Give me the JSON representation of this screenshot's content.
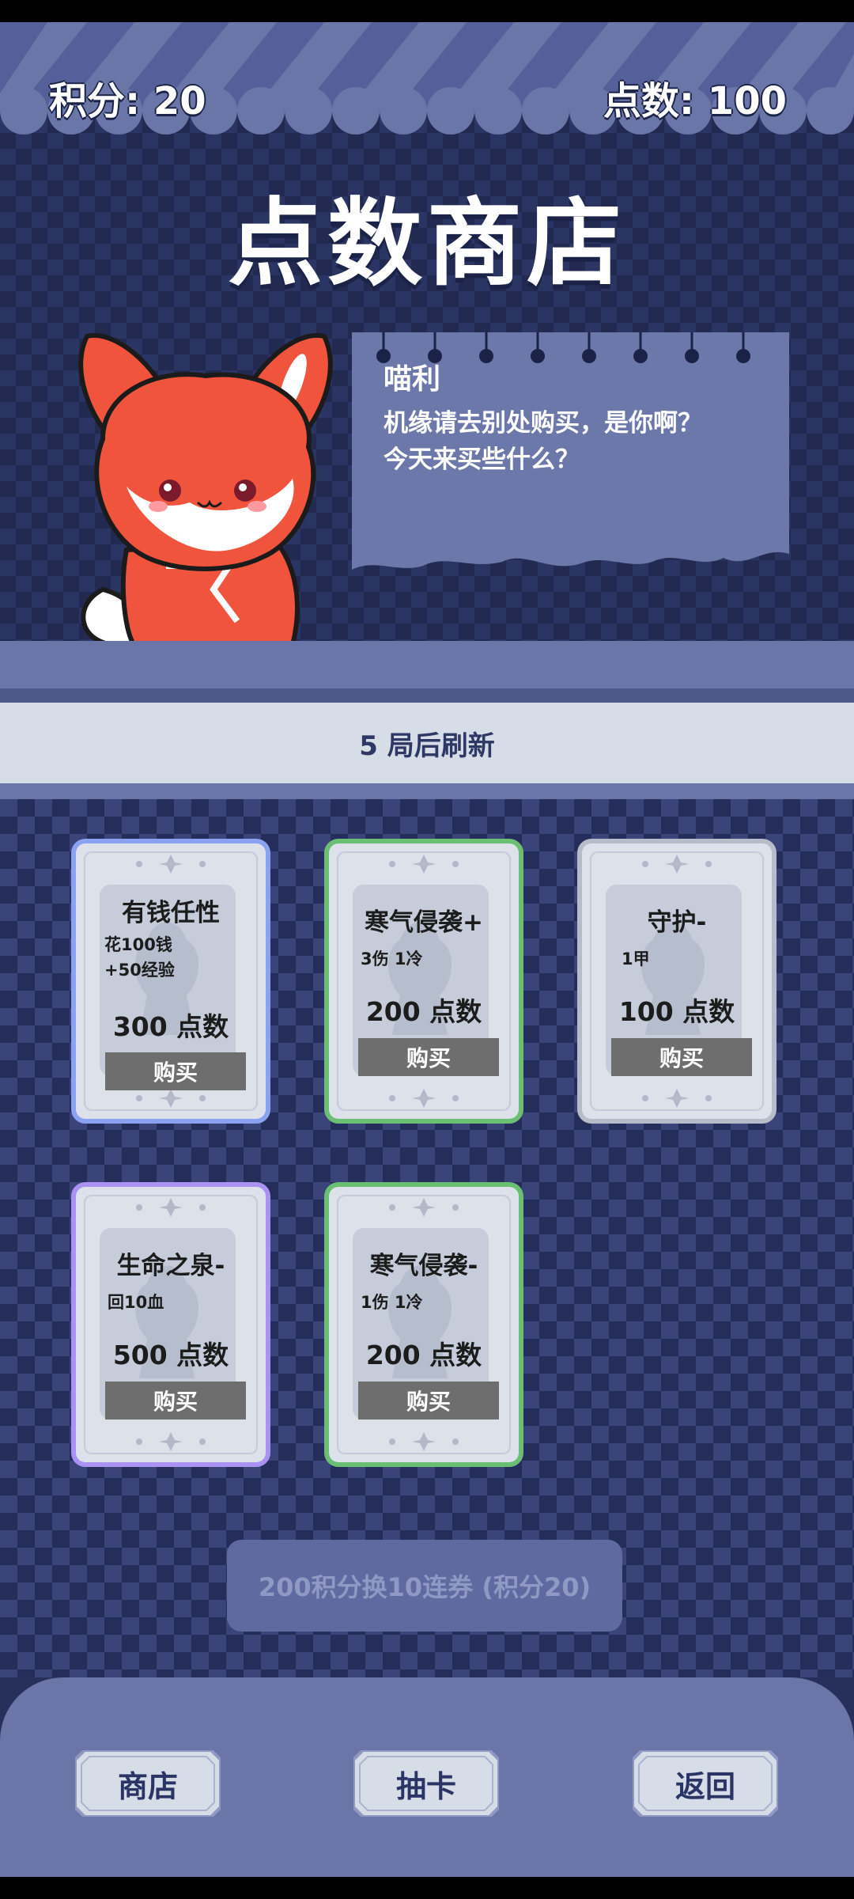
{
  "header": {
    "score_label": "积分: 20",
    "points_label": "点数: 100"
  },
  "title": "点数商店",
  "npc": {
    "name": "喵利",
    "dialog": "机缘请去别处购买，是你啊？今天来买些什么？"
  },
  "refresh_text": "5 局后刷新",
  "cards": [
    {
      "name": "有钱任性",
      "desc": "花100钱\n+50经验",
      "price": "300 点数",
      "buy": "购买",
      "rarity_color": "#8aa2f0"
    },
    {
      "name": "寒气侵袭+",
      "desc": "3伤 1冷",
      "price": "200 点数",
      "buy": "购买",
      "rarity_color": "#6bbf72"
    },
    {
      "name": "守护-",
      "desc": "1甲",
      "price": "100 点数",
      "buy": "购买",
      "rarity_color": "#b7bccb"
    },
    {
      "name": "生命之泉-",
      "desc": "回10血",
      "price": "500 点数",
      "buy": "购买",
      "rarity_color": "#a992f2"
    },
    {
      "name": "寒气侵袭-",
      "desc": "1伤 1冷",
      "price": "200 点数",
      "buy": "购买",
      "rarity_color": "#6bbf72"
    }
  ],
  "exchange_button": "200积分换10连券 (积分20)",
  "nav": {
    "shop": "商店",
    "gacha": "抽卡",
    "back": "返回"
  }
}
